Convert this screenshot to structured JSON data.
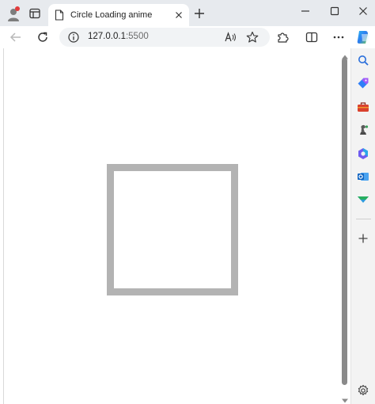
{
  "browser": {
    "tab": {
      "title": "Circle Loading anime"
    },
    "address_bar": {
      "host": "127.0.0.1",
      "port": ":5500"
    }
  },
  "colors": {
    "square_border": "#b3b3b3",
    "titlebar_bg": "#e7eaee",
    "scrollbar_thumb": "#8a8a8a"
  },
  "icons": {
    "profile": "profile-icon",
    "tab_actions": "tab-actions-icon",
    "page": "page-icon",
    "close_tab": "close-icon",
    "new_tab": "plus-icon",
    "back": "back-arrow-icon",
    "reload": "reload-icon",
    "info": "info-icon",
    "read_aloud": "read-aloud-icon",
    "favorite": "star-icon",
    "extensions": "puzzle-icon",
    "split_screen": "split-screen-icon",
    "more": "ellipsis-icon",
    "copilot": "copilot-icon",
    "sidebar": [
      "search-icon",
      "tag-icon",
      "toolbox-icon",
      "chess-icon",
      "m365-icon",
      "outlook-icon",
      "drop-icon",
      "plus-icon",
      "gear-icon"
    ]
  }
}
